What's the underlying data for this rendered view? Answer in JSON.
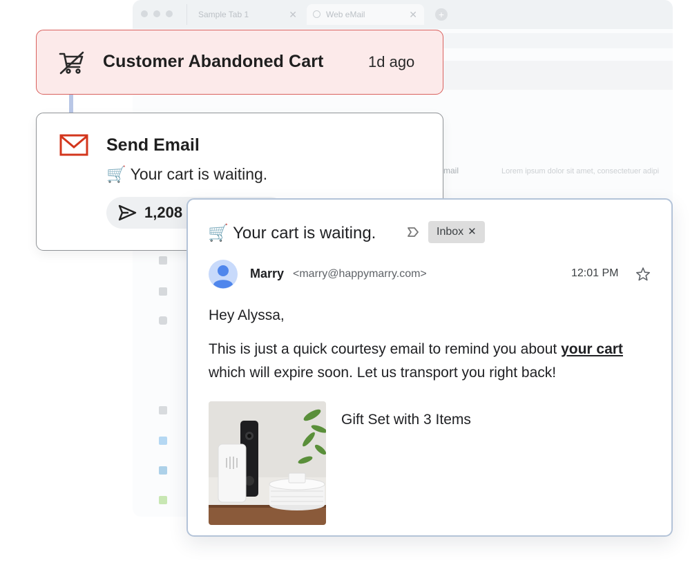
{
  "background_browser": {
    "tabs": [
      {
        "label": "Sample Tab 1",
        "close": "✕"
      },
      {
        "label": "Web eMail",
        "close": "✕"
      }
    ],
    "new_tab_icon": "plus-icon",
    "inbox_row": {
      "label": "mail",
      "preview": "Lorem ipsum dolor sit amet, consectetuer adipi"
    }
  },
  "trigger": {
    "icon": "cart-off-icon",
    "title": "Customer Abandoned Cart",
    "time": "1d ago",
    "colors": {
      "background": "#fceaea",
      "border": "#d9605d"
    }
  },
  "action": {
    "icon": "mail-icon",
    "title": "Send Email",
    "subject": "🛒 Your cart is waiting.",
    "sent_icon": "send-icon",
    "sent_count": "1,208",
    "colors": {
      "mail_icon": "#d3361c"
    }
  },
  "email": {
    "subject": "🛒 Your cart is waiting.",
    "label_icon": "label-icon",
    "chip": {
      "label": "Inbox",
      "close": "✕"
    },
    "sender": {
      "avatar": "avatar-icon",
      "name": "Marry",
      "email": "<marry@happymarry.com>"
    },
    "time": "12:01 PM",
    "star_icon": "star-icon",
    "greeting": "Hey Alyssa,",
    "body": {
      "before": "This is just a quick courtesy email to remind you about ",
      "link": "your cart",
      "after": " which will expire soon. Let us transport you right back!"
    },
    "product": {
      "image": "product-photo",
      "name": "Gift Set with 3 Items"
    },
    "colors": {
      "avatar": "#5b8def",
      "border": "#b3c3d8"
    }
  }
}
